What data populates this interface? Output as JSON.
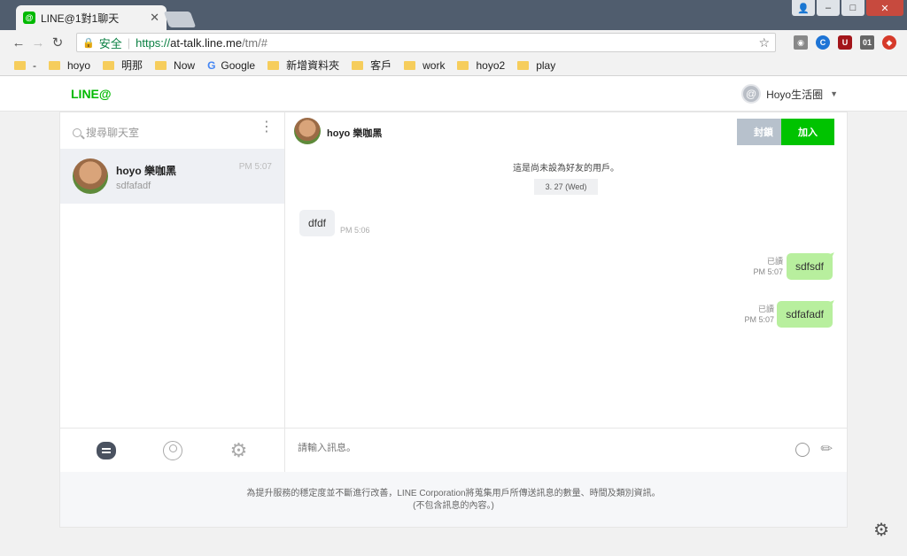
{
  "browser": {
    "tab_title": "LINE@1對1聊天",
    "tab_favicon": "@",
    "secure_label": "安全",
    "url_scheme": "https://",
    "url_host": "at-talk.line.me",
    "url_path": "/tm/#",
    "bookmarks": [
      {
        "label": "-",
        "icon": "folder-icon"
      },
      {
        "label": "hoyo",
        "icon": "folder-icon"
      },
      {
        "label": "明那",
        "icon": "folder-icon"
      },
      {
        "label": "Now",
        "icon": "folder-icon"
      },
      {
        "label": "Google",
        "icon": "google-icon"
      },
      {
        "label": "新增資料夾",
        "icon": "folder-icon"
      },
      {
        "label": "客戶",
        "icon": "folder-icon"
      },
      {
        "label": "work",
        "icon": "folder-icon"
      },
      {
        "label": "hoyo2",
        "icon": "folder-icon"
      },
      {
        "label": "play",
        "icon": "folder-icon"
      }
    ],
    "extension_badges": [
      "C",
      "U",
      "01"
    ]
  },
  "app": {
    "logo": "LINE@",
    "account_name": "Hoyo生活圈",
    "account_avatar": "@"
  },
  "sidebar": {
    "search_placeholder": "搜尋聊天室",
    "chats": [
      {
        "name": "hoyo 樂咖黑",
        "preview": "sdfafadf",
        "time": "PM 5:07"
      }
    ]
  },
  "conversation": {
    "contact_name": "hoyo 樂咖黑",
    "block_label": "封鎖",
    "add_label": "加入",
    "notice": "這是尚未設為好友的用戶。",
    "date": "3. 27 (Wed)",
    "messages": [
      {
        "direction": "in",
        "text": "dfdf",
        "time": "PM 5:06"
      },
      {
        "direction": "out",
        "text": "sdfsdf",
        "read": "已讀",
        "time": "PM 5:07"
      },
      {
        "direction": "out",
        "text": "sdfafadf",
        "read": "已讀",
        "time": "PM 5:07"
      }
    ],
    "input_placeholder": "請輸入訊息。"
  },
  "footer": {
    "line1": "為提升服務的穩定度並不斷進行改善，LINE Corporation將蒐集用戶所傳送訊息的數量、時間及類別資訊。",
    "line2": "(不包含訊息的內容。)"
  },
  "colors": {
    "line_green": "#00b900",
    "bubble_out": "#b8ef9e",
    "bubble_in": "#eef0f3",
    "block_button": "#b7c1cc"
  }
}
